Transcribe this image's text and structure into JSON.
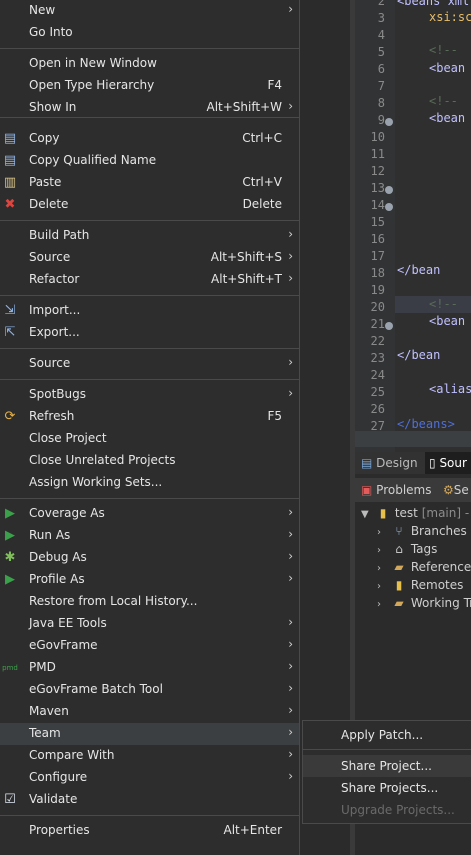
{
  "menu": {
    "items": [
      {
        "label": "New",
        "shortcut": "",
        "submenu": true,
        "icon": ""
      },
      {
        "label": "Go Into",
        "shortcut": "",
        "submenu": false,
        "icon": ""
      },
      {
        "label": "Open in New Window",
        "shortcut": "",
        "submenu": false,
        "icon": ""
      },
      {
        "label": "Open Type Hierarchy",
        "shortcut": "F4",
        "submenu": false,
        "icon": ""
      },
      {
        "label": "Show In",
        "shortcut": "Alt+Shift+W",
        "submenu": true,
        "icon": ""
      },
      {
        "label": "Copy",
        "shortcut": "Ctrl+C",
        "submenu": false,
        "icon": "copy-icon"
      },
      {
        "label": "Copy Qualified Name",
        "shortcut": "",
        "submenu": false,
        "icon": "copy-qualified-icon"
      },
      {
        "label": "Paste",
        "shortcut": "Ctrl+V",
        "submenu": false,
        "icon": "paste-icon"
      },
      {
        "label": "Delete",
        "shortcut": "Delete",
        "submenu": false,
        "icon": "delete-icon"
      },
      {
        "label": "Build Path",
        "shortcut": "",
        "submenu": true,
        "icon": ""
      },
      {
        "label": "Source",
        "shortcut": "Alt+Shift+S",
        "submenu": true,
        "icon": ""
      },
      {
        "label": "Refactor",
        "shortcut": "Alt+Shift+T",
        "submenu": true,
        "icon": ""
      },
      {
        "label": "Import...",
        "shortcut": "",
        "submenu": false,
        "icon": "import-icon"
      },
      {
        "label": "Export...",
        "shortcut": "",
        "submenu": false,
        "icon": "export-icon"
      },
      {
        "label": "Source",
        "shortcut": "",
        "submenu": true,
        "icon": ""
      },
      {
        "label": "SpotBugs",
        "shortcut": "",
        "submenu": true,
        "icon": ""
      },
      {
        "label": "Refresh",
        "shortcut": "F5",
        "submenu": false,
        "icon": "refresh-icon"
      },
      {
        "label": "Close Project",
        "shortcut": "",
        "submenu": false,
        "icon": ""
      },
      {
        "label": "Close Unrelated Projects",
        "shortcut": "",
        "submenu": false,
        "icon": ""
      },
      {
        "label": "Assign Working Sets...",
        "shortcut": "",
        "submenu": false,
        "icon": ""
      },
      {
        "label": "Coverage As",
        "shortcut": "",
        "submenu": true,
        "icon": "coverage-icon"
      },
      {
        "label": "Run As",
        "shortcut": "",
        "submenu": true,
        "icon": "run-icon"
      },
      {
        "label": "Debug As",
        "shortcut": "",
        "submenu": true,
        "icon": "debug-icon"
      },
      {
        "label": "Profile As",
        "shortcut": "",
        "submenu": true,
        "icon": "profile-icon"
      },
      {
        "label": "Restore from Local History...",
        "shortcut": "",
        "submenu": false,
        "icon": ""
      },
      {
        "label": "Java EE Tools",
        "shortcut": "",
        "submenu": true,
        "icon": ""
      },
      {
        "label": "eGovFrame",
        "shortcut": "",
        "submenu": true,
        "icon": ""
      },
      {
        "label": "PMD",
        "shortcut": "",
        "submenu": true,
        "icon": "pmd-icon"
      },
      {
        "label": "eGovFrame Batch Tool",
        "shortcut": "",
        "submenu": true,
        "icon": ""
      },
      {
        "label": "Maven",
        "shortcut": "",
        "submenu": true,
        "icon": ""
      },
      {
        "label": "Team",
        "shortcut": "",
        "submenu": true,
        "icon": ""
      },
      {
        "label": "Compare With",
        "shortcut": "",
        "submenu": true,
        "icon": ""
      },
      {
        "label": "Configure",
        "shortcut": "",
        "submenu": true,
        "icon": ""
      },
      {
        "label": "Validate",
        "shortcut": "",
        "submenu": false,
        "icon": "checkbox-checked-icon"
      },
      {
        "label": "Properties",
        "shortcut": "Alt+Enter",
        "submenu": false,
        "icon": ""
      }
    ],
    "submenu_arrow": "›"
  },
  "team_submenu": {
    "items": [
      {
        "label": "Apply Patch...",
        "enabled": true
      },
      {
        "label": "Share Project...",
        "enabled": true
      },
      {
        "label": "Share Projects...",
        "enabled": true
      },
      {
        "label": "Upgrade Projects...",
        "enabled": false
      }
    ]
  },
  "editor": {
    "lines": [
      "2",
      "3",
      "4",
      "5",
      "6",
      "7",
      "8",
      "9",
      "10",
      "11",
      "12",
      "13",
      "14",
      "15",
      "16",
      "17",
      "18",
      "19",
      "20",
      "21",
      "22",
      "23",
      "24",
      "25",
      "26",
      "27"
    ],
    "code": {
      "l2": "<beans xml",
      "l3": "xsi:sc",
      "l5": "<!--",
      "l6": "<bean",
      "l8": "<!--",
      "l9": "<bean",
      "l18": "</bean",
      "l20": "<!--",
      "l21": "<bean",
      "l23": "</bean",
      "l25": "<alias",
      "l27": "</beans>"
    },
    "tabs": {
      "design": "Design",
      "source": "Sour"
    }
  },
  "panel": {
    "tabs": {
      "problems": "Problems",
      "second": "Se"
    },
    "repo": {
      "name": "test",
      "branch": "[main] - C"
    },
    "children": [
      "Branches",
      "Tags",
      "References",
      "Remotes",
      "Working Tr"
    ]
  },
  "colors": {
    "menu_bg": "#2d2d2d",
    "active_bg": "#3c3f41",
    "delete_red": "#e0443e",
    "run_green": "#3aa14a"
  }
}
